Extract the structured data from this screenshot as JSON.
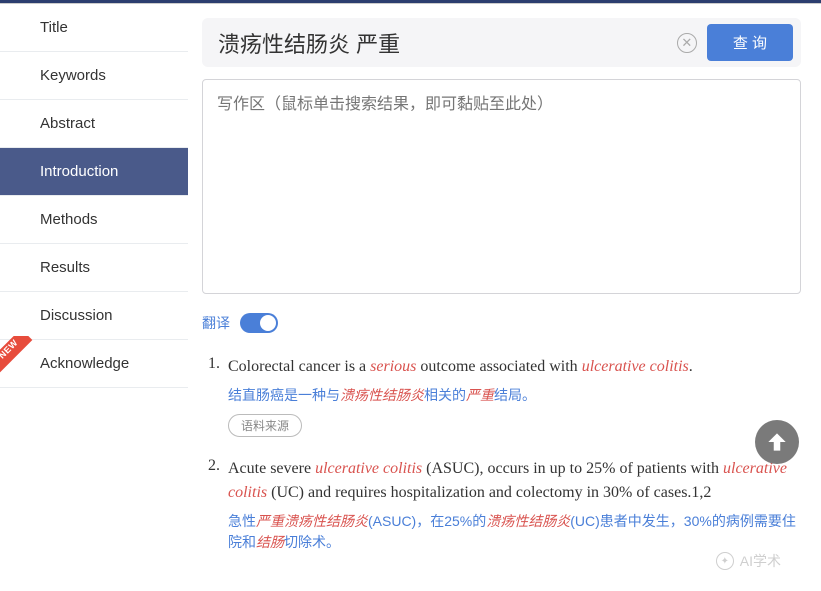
{
  "sidebar": {
    "items": [
      {
        "label": "Title",
        "active": false
      },
      {
        "label": "Keywords",
        "active": false
      },
      {
        "label": "Abstract",
        "active": false
      },
      {
        "label": "Introduction",
        "active": true
      },
      {
        "label": "Methods",
        "active": false
      },
      {
        "label": "Results",
        "active": false
      },
      {
        "label": "Discussion",
        "active": false
      },
      {
        "label": "Acknowledge",
        "active": false,
        "new": true
      }
    ],
    "new_badge_text": "NEW"
  },
  "search": {
    "value": "溃疡性结肠炎 严重",
    "clear_symbol": "✕",
    "query_label": "查 询"
  },
  "textarea": {
    "placeholder": "写作区（鼠标单击搜索结果，即可黏贴至此处）"
  },
  "translate": {
    "label": "翻译",
    "on": true
  },
  "results": [
    {
      "num": "1.",
      "en_parts": [
        {
          "t": "Colorectal cancer is a "
        },
        {
          "t": "serious",
          "hl": true
        },
        {
          "t": " outcome associated with "
        },
        {
          "t": "ulcerative colitis",
          "hl": true
        },
        {
          "t": "."
        }
      ],
      "zh_parts": [
        {
          "t": "结直肠癌是一种与"
        },
        {
          "t": "溃疡性结肠炎",
          "hl": true
        },
        {
          "t": "相关的"
        },
        {
          "t": "严重",
          "hl": true
        },
        {
          "t": "结局。"
        }
      ],
      "source_label": "语料来源"
    },
    {
      "num": "2.",
      "en_parts": [
        {
          "t": "Acute severe "
        },
        {
          "t": "ulcerative colitis",
          "hl": true
        },
        {
          "t": " (ASUC), occurs in up to 25% of patients with "
        },
        {
          "t": "ulcerative colitis",
          "hl": true
        },
        {
          "t": " (UC) and requires hospitalization and colectomy in 30% of cases.1,2"
        }
      ],
      "zh_parts": [
        {
          "t": "急性"
        },
        {
          "t": "严重溃疡性结肠炎",
          "hl": true
        },
        {
          "t": "(ASUC)，在25%的"
        },
        {
          "t": "溃疡性结肠炎",
          "hl": true
        },
        {
          "t": "(UC)患者中发生，30%的病例需要住院和"
        },
        {
          "t": "结肠",
          "hl": true
        },
        {
          "t": "切除术。"
        }
      ]
    }
  ],
  "watermark": {
    "text": "AI学术"
  }
}
